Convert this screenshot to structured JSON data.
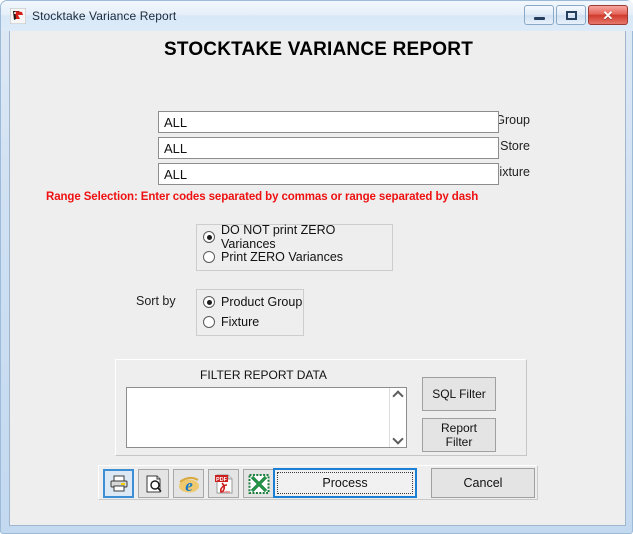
{
  "window": {
    "title": "Stocktake Variance Report",
    "app_icon": "falcon-logo-icon",
    "controls": {
      "minimize": "minimize-icon",
      "maximize": "maximize-icon",
      "close": "✕"
    }
  },
  "page": {
    "heading": "STOCKTAKE VARIANCE REPORT",
    "range_note": "Range Selection:  Enter codes separated by commas or range separated by dash",
    "note_color": "#ee1111"
  },
  "fields": [
    {
      "label": "Product Group",
      "value": "ALL",
      "placeholder": ""
    },
    {
      "label": "Store",
      "value": "ALL",
      "placeholder": ""
    },
    {
      "label": "Fixture",
      "value": "ALL",
      "placeholder": ""
    }
  ],
  "zero_variance_group": {
    "options": [
      {
        "label": "DO NOT print ZERO Variances",
        "checked": true
      },
      {
        "label": "Print ZERO Variances",
        "checked": false
      }
    ]
  },
  "sort_group": {
    "label": "Sort by",
    "options": [
      {
        "label": "Product Group",
        "checked": true
      },
      {
        "label": "Fixture",
        "checked": false
      }
    ]
  },
  "filter_panel": {
    "caption": "FILTER REPORT DATA",
    "textarea_value": "",
    "textarea_placeholder": "",
    "scroll_up": "scroll-up-icon",
    "scroll_down": "scroll-down-icon",
    "buttons": [
      {
        "label": "SQL Filter"
      },
      {
        "label": "Report Filter"
      }
    ]
  },
  "toolbar": {
    "icons": [
      {
        "name": "print-icon",
        "focused": true
      },
      {
        "name": "print-preview-icon",
        "focused": false
      },
      {
        "name": "internet-explorer-icon",
        "focused": false
      },
      {
        "name": "pdf-export-icon",
        "label": "PDF",
        "sublabel": "Adobe",
        "focused": false
      },
      {
        "name": "excel-export-icon",
        "label": "X",
        "focused": false
      }
    ],
    "process_label": "Process",
    "cancel_label": "Cancel"
  }
}
